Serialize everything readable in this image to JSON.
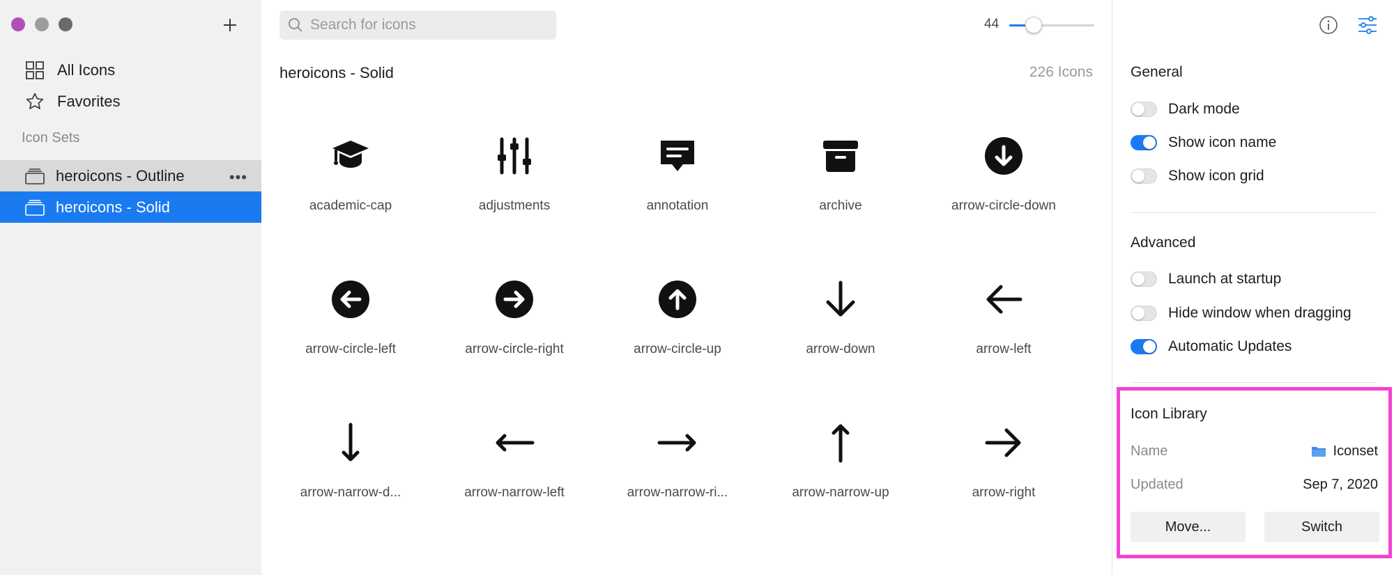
{
  "window": {
    "traffic_colors": [
      "#b04fb6",
      "#9c9c9c",
      "#6a6a6a"
    ]
  },
  "sidebar": {
    "nav": [
      {
        "label": "All Icons",
        "icon": "grid-icon"
      },
      {
        "label": "Favorites",
        "icon": "star-icon"
      }
    ],
    "sets_label": "Icon Sets",
    "sets": [
      {
        "label": "heroicons - Outline",
        "icon": "collection-icon",
        "more": "•••"
      },
      {
        "label": "heroicons - Solid",
        "icon": "collection-icon",
        "selected": true
      }
    ],
    "accent": "#1a7bf0"
  },
  "toolbar": {
    "search_placeholder": "Search for icons",
    "icon_size": "44",
    "size_slider_fraction": 0.19
  },
  "main": {
    "title": "heroicons - Solid",
    "count": "226 Icons",
    "icons": [
      {
        "label": "academic-cap",
        "icon": "academic-cap-icon"
      },
      {
        "label": "adjustments",
        "icon": "adjustments-icon"
      },
      {
        "label": "annotation",
        "icon": "annotation-icon"
      },
      {
        "label": "archive",
        "icon": "archive-icon"
      },
      {
        "label": "arrow-circle-down",
        "icon": "arrow-circle-down-icon"
      },
      {
        "label": "arrow-circle-left",
        "icon": "arrow-circle-left-icon"
      },
      {
        "label": "arrow-circle-right",
        "icon": "arrow-circle-right-icon"
      },
      {
        "label": "arrow-circle-up",
        "icon": "arrow-circle-up-icon"
      },
      {
        "label": "arrow-down",
        "icon": "arrow-down-icon"
      },
      {
        "label": "arrow-left",
        "icon": "arrow-left-icon"
      },
      {
        "label": "arrow-narrow-d...",
        "icon": "arrow-narrow-down-icon"
      },
      {
        "label": "arrow-narrow-left",
        "icon": "arrow-narrow-left-icon"
      },
      {
        "label": "arrow-narrow-ri...",
        "icon": "arrow-narrow-right-icon"
      },
      {
        "label": "arrow-narrow-up",
        "icon": "arrow-narrow-up-icon"
      },
      {
        "label": "arrow-right",
        "icon": "arrow-right-icon"
      }
    ]
  },
  "settings": {
    "general": {
      "heading": "General",
      "toggles": [
        {
          "label": "Dark mode",
          "on": false
        },
        {
          "label": "Show icon name",
          "on": true
        },
        {
          "label": "Show icon grid",
          "on": false
        }
      ]
    },
    "advanced": {
      "heading": "Advanced",
      "toggles": [
        {
          "label": "Launch at startup",
          "on": false
        },
        {
          "label": "Hide window when dragging",
          "on": false
        },
        {
          "label": "Automatic Updates",
          "on": true
        }
      ]
    },
    "library": {
      "heading": "Icon Library",
      "name_key": "Name",
      "name_value": "Iconset",
      "updated_key": "Updated",
      "updated_value": "Sep 7, 2020",
      "move_button": "Move...",
      "switch_button": "Switch",
      "highlight_color": "#f542d4"
    }
  }
}
